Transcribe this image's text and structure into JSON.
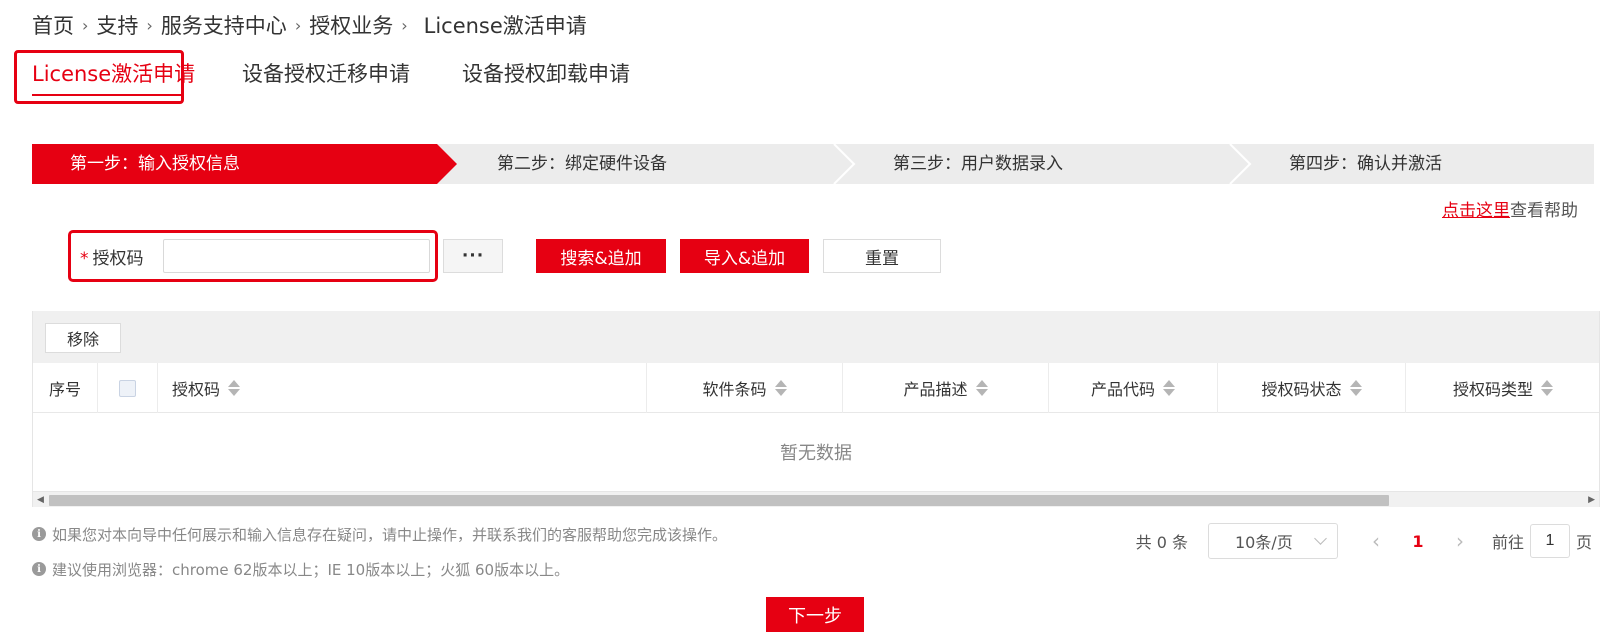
{
  "breadcrumb": {
    "items": [
      "首页",
      "支持",
      "服务支持中心",
      "授权业务"
    ],
    "current": "License激活申请",
    "separator": "›"
  },
  "tabs": [
    {
      "label": "License激活申请",
      "active": true
    },
    {
      "label": "设备授权迁移申请",
      "active": false
    },
    {
      "label": "设备授权卸载申请",
      "active": false
    }
  ],
  "steps": [
    {
      "label": "第一步：输入授权信息",
      "active": true
    },
    {
      "label": "第二步：绑定硬件设备",
      "active": false
    },
    {
      "label": "第三步：用户数据录入",
      "active": false
    },
    {
      "label": "第四步：确认并激活",
      "active": false
    }
  ],
  "help": {
    "link": "点击这里",
    "text": "查看帮助"
  },
  "form": {
    "required_mark": "*",
    "label": "授权码",
    "input_value": "",
    "input_placeholder": "",
    "more_label": "···",
    "search_add_label": "搜索&追加",
    "import_add_label": "导入&追加",
    "reset_label": "重置"
  },
  "table": {
    "remove_label": "移除",
    "columns": [
      "序号",
      "",
      "授权码",
      "软件条码",
      "产品描述",
      "产品代码",
      "授权码状态",
      "授权码类型"
    ],
    "empty_text": "暂无数据"
  },
  "notes": [
    "如果您对本向导中任何展示和输入信息存在疑问，请中止操作，并联系我们的客服帮助您完成该操作。",
    "建议使用浏览器：chrome 62版本以上；IE 10版本以上；火狐 60版本以上。"
  ],
  "pagination": {
    "total": "共 0 条",
    "page_size": "10条/页",
    "current_page": "1",
    "goto_prefix": "前往",
    "goto_value": "1",
    "goto_suffix": "页"
  },
  "next_label": "下一步",
  "colors": {
    "accent": "#e60012",
    "step_inactive": "#ececec"
  }
}
